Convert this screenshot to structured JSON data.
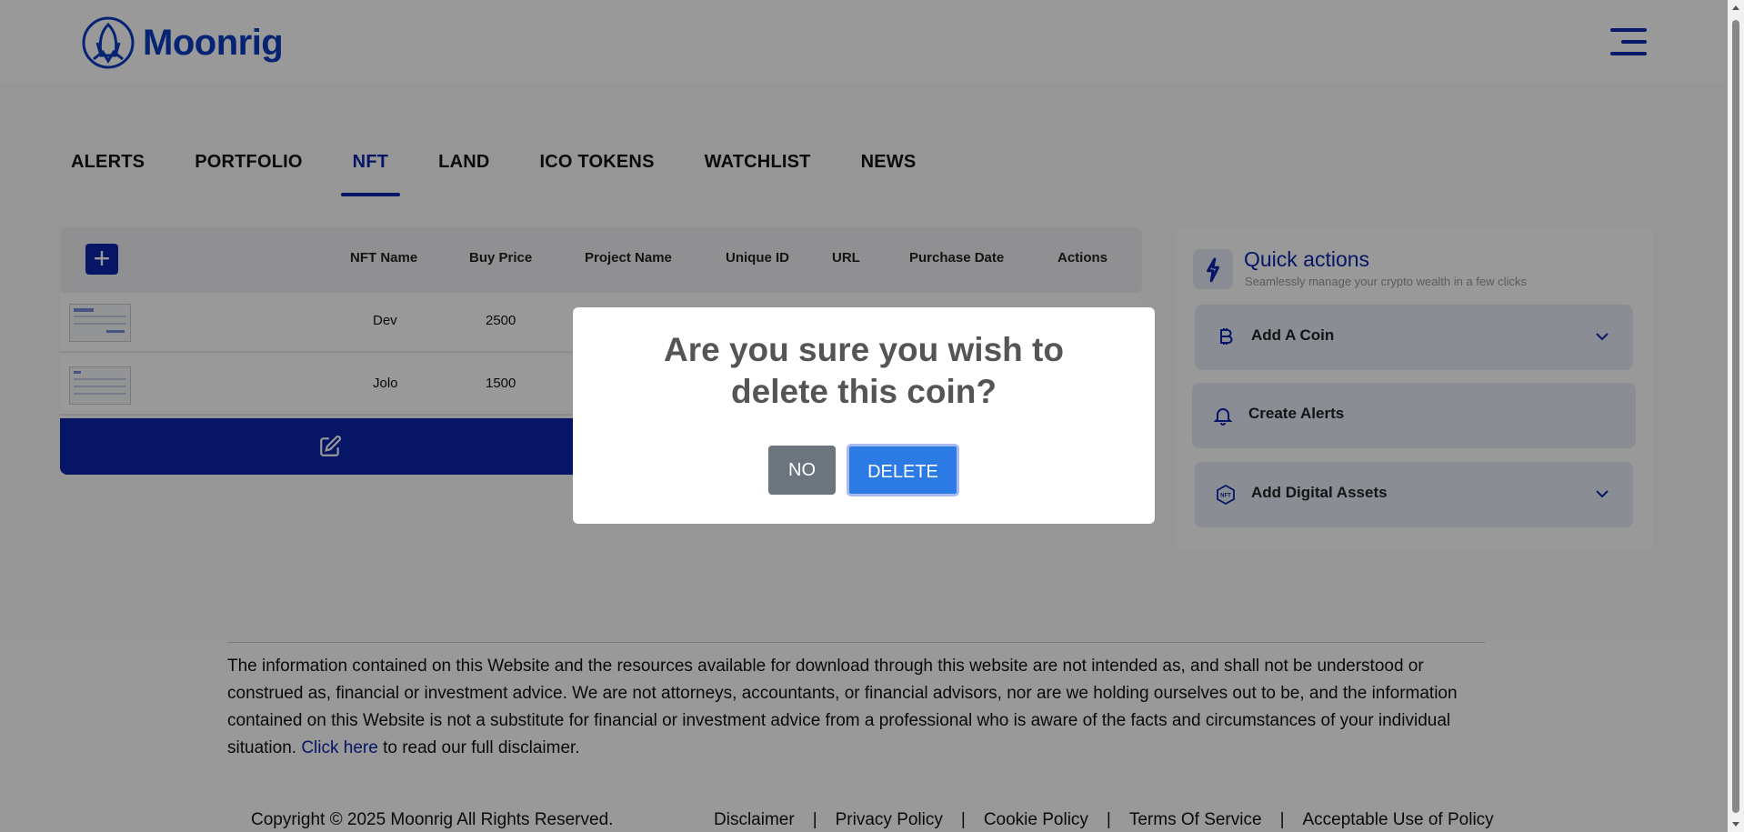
{
  "header": {
    "brand": "Moonrig"
  },
  "tabs": [
    {
      "label": "ALERTS"
    },
    {
      "label": "PORTFOLIO"
    },
    {
      "label": "NFT",
      "active": true
    },
    {
      "label": "LAND"
    },
    {
      "label": "ICO TOKENS"
    },
    {
      "label": "WATCHLIST"
    },
    {
      "label": "NEWS"
    }
  ],
  "table": {
    "add_icon": "+",
    "columns": [
      "NFT Name",
      "Buy Price",
      "Project Name",
      "Unique ID",
      "URL",
      "Purchase Date",
      "Actions"
    ],
    "rows": [
      {
        "name": "Dev",
        "buy_price": "2500"
      },
      {
        "name": "Jolo",
        "buy_price": "1500"
      }
    ]
  },
  "quick_actions": {
    "title": "Quick actions",
    "subtitle": "Seamlessly manage your crypto wealth in a few clicks",
    "items": [
      {
        "label": "Add A Coin",
        "icon": "bitcoin-icon"
      },
      {
        "label": "Create Alerts",
        "icon": "bell-icon"
      },
      {
        "label": "Add Digital Assets",
        "icon": "nft-icon"
      }
    ]
  },
  "footer": {
    "disclaimer": "The information contained on this Website and the resources available for download through this website are not intended as, and shall not be understood or construed as, financial or investment advice. We are not attorneys, accountants, or financial advisors, nor are we holding ourselves out to be, and the information contained on this Website is not a substitute for financial or investment advice from a professional who is aware of the facts and circumstances of your individual situation.",
    "click_here": "Click here",
    "disclaimer_tail": "to read our full disclaimer.",
    "copyright": "Copyright © 2025 Moonrig All Rights Reserved.",
    "links": [
      "Disclaimer",
      "Privacy Policy",
      "Cookie Policy",
      "Terms Of Service",
      "Acceptable Use of Policy"
    ],
    "separator": "|"
  },
  "modal": {
    "title": "Are you sure you wish to delete this coin?",
    "no_label": "NO",
    "delete_label": "DELETE"
  },
  "colors": {
    "brand": "#0b24a8",
    "no_button": "#6c757d",
    "delete_button": "#2c7be5"
  }
}
